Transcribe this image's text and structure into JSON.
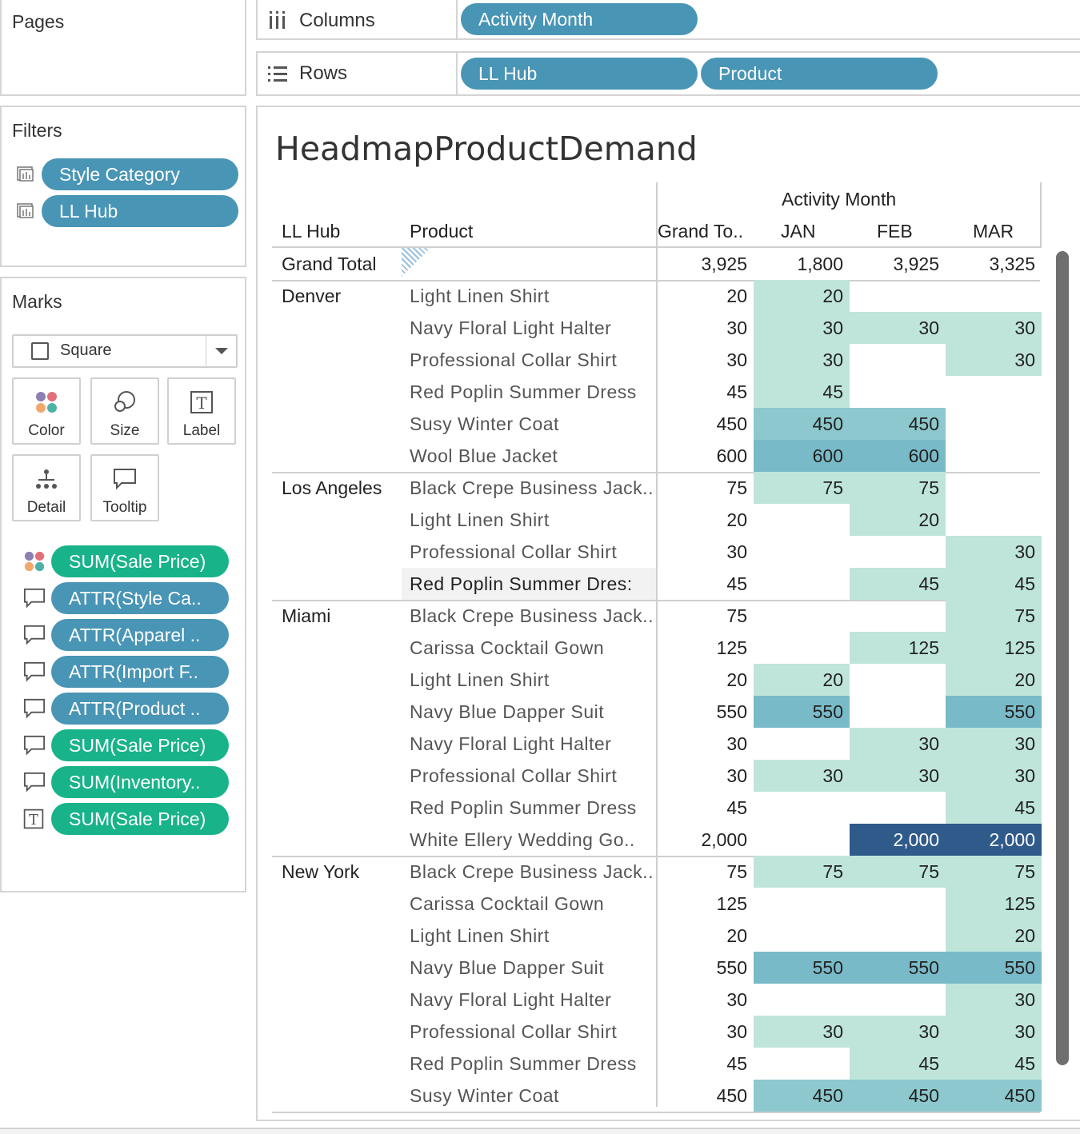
{
  "pages": {
    "title": "Pages"
  },
  "filters": {
    "title": "Filters",
    "items": [
      {
        "label": "Style Category"
      },
      {
        "label": "LL Hub"
      }
    ]
  },
  "marks": {
    "title": "Marks",
    "type": "Square",
    "buttons": [
      {
        "label": "Color",
        "icon": "color-icon"
      },
      {
        "label": "Size",
        "icon": "size-icon"
      },
      {
        "label": "Label",
        "icon": "label-icon"
      },
      {
        "label": "Detail",
        "icon": "detail-icon"
      },
      {
        "label": "Tooltip",
        "icon": "tooltip-icon"
      }
    ],
    "fields": [
      {
        "icon": "color-icon",
        "label": "SUM(Sale Price)",
        "color": "#19b38a"
      },
      {
        "icon": "tooltip-icon",
        "label": "ATTR(Style Ca..",
        "color": "#4995b5"
      },
      {
        "icon": "tooltip-icon",
        "label": "ATTR(Apparel ..",
        "color": "#4995b5"
      },
      {
        "icon": "tooltip-icon",
        "label": "ATTR(Import F..",
        "color": "#4995b5"
      },
      {
        "icon": "tooltip-icon",
        "label": "ATTR(Product ..",
        "color": "#4995b5"
      },
      {
        "icon": "tooltip-icon",
        "label": "SUM(Sale Price)",
        "color": "#19b38a"
      },
      {
        "icon": "tooltip-icon",
        "label": "SUM(Inventory..",
        "color": "#19b38a"
      },
      {
        "icon": "label-icon",
        "label": "SUM(Sale Price)",
        "color": "#19b38a"
      }
    ]
  },
  "columns_shelf": {
    "label": "Columns",
    "pills": [
      "Activity Month"
    ]
  },
  "rows_shelf": {
    "label": "Rows",
    "pills": [
      "LL Hub",
      "Product"
    ]
  },
  "view": {
    "title": "HeadmapProductDemand",
    "column_group_header": "Activity Month",
    "headers": {
      "hub": "LL Hub",
      "product": "Product",
      "grand_total": "Grand To..",
      "months": [
        "JAN",
        "FEB",
        "MAR"
      ]
    },
    "grand_total_row": {
      "label": "Grand Total",
      "total": "3,925",
      "months": [
        "1,800",
        "3,925",
        "3,325"
      ]
    },
    "groups": [
      {
        "hub": "Denver",
        "rows": [
          {
            "product": "Light Linen Shirt",
            "total": "20",
            "values": [
              "20",
              "",
              ""
            ]
          },
          {
            "product": "Navy Floral Light Halter",
            "total": "30",
            "values": [
              "30",
              "30",
              "30"
            ]
          },
          {
            "product": "Professional Collar Shirt",
            "total": "30",
            "values": [
              "30",
              "",
              "30"
            ]
          },
          {
            "product": "Red Poplin Summer Dress",
            "total": "45",
            "values": [
              "45",
              "",
              ""
            ]
          },
          {
            "product": "Susy Winter Coat",
            "total": "450",
            "values": [
              "450",
              "450",
              ""
            ]
          },
          {
            "product": "Wool Blue Jacket",
            "total": "600",
            "values": [
              "600",
              "600",
              ""
            ]
          }
        ]
      },
      {
        "hub": "Los Angeles",
        "rows": [
          {
            "product": "Black Crepe Business Jack..",
            "total": "75",
            "values": [
              "75",
              "75",
              ""
            ]
          },
          {
            "product": "Light Linen Shirt",
            "total": "20",
            "values": [
              "",
              "20",
              ""
            ]
          },
          {
            "product": "Professional Collar Shirt",
            "total": "30",
            "values": [
              "",
              "",
              "30"
            ]
          },
          {
            "product": "Red Poplin Summer Dres:",
            "total": "45",
            "values": [
              "",
              "45",
              "45"
            ],
            "highlight": true
          }
        ]
      },
      {
        "hub": "Miami",
        "rows": [
          {
            "product": "Black Crepe Business Jack..",
            "total": "75",
            "values": [
              "",
              "",
              "75"
            ]
          },
          {
            "product": "Carissa Cocktail Gown",
            "total": "125",
            "values": [
              "",
              "125",
              "125"
            ]
          },
          {
            "product": "Light Linen Shirt",
            "total": "20",
            "values": [
              "20",
              "",
              "20"
            ]
          },
          {
            "product": "Navy Blue Dapper Suit",
            "total": "550",
            "values": [
              "550",
              "",
              "550"
            ]
          },
          {
            "product": "Navy Floral Light Halter",
            "total": "30",
            "values": [
              "",
              "30",
              "30"
            ]
          },
          {
            "product": "Professional Collar Shirt",
            "total": "30",
            "values": [
              "30",
              "30",
              "30"
            ]
          },
          {
            "product": "Red Poplin Summer Dress",
            "total": "45",
            "values": [
              "",
              "",
              "45"
            ]
          },
          {
            "product": "White Ellery Wedding Go..",
            "total": "2,000",
            "values": [
              "",
              "2,000",
              "2,000"
            ]
          }
        ]
      },
      {
        "hub": "New York",
        "rows": [
          {
            "product": "Black Crepe Business Jack..",
            "total": "75",
            "values": [
              "75",
              "75",
              "75"
            ]
          },
          {
            "product": "Carissa Cocktail Gown",
            "total": "125",
            "values": [
              "",
              "",
              "125"
            ]
          },
          {
            "product": "Light Linen Shirt",
            "total": "20",
            "values": [
              "",
              "",
              "20"
            ]
          },
          {
            "product": "Navy Blue Dapper Suit",
            "total": "550",
            "values": [
              "550",
              "550",
              "550"
            ]
          },
          {
            "product": "Navy Floral Light Halter",
            "total": "30",
            "values": [
              "",
              "",
              "30"
            ]
          },
          {
            "product": "Professional Collar Shirt",
            "total": "30",
            "values": [
              "30",
              "30",
              "30"
            ]
          },
          {
            "product": "Red Poplin Summer Dress",
            "total": "45",
            "values": [
              "",
              "45",
              "45"
            ]
          },
          {
            "product": "Susy Winter Coat",
            "total": "450",
            "values": [
              "450",
              "450",
              "450"
            ]
          }
        ]
      }
    ],
    "heat_colors": {
      "low": "#bfe5da",
      "mid": "#8cc8cd",
      "high": "#79bac9",
      "max": "#2f5a8a"
    }
  }
}
